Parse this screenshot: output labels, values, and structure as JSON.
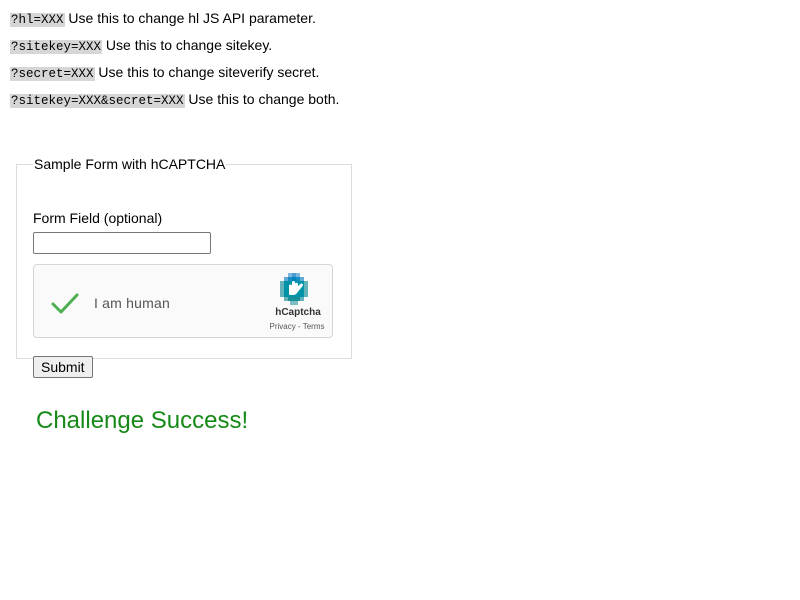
{
  "params": [
    {
      "code": "?hl=XXX",
      "text": " Use this to change hl JS API parameter."
    },
    {
      "code": "?sitekey=XXX",
      "text": " Use this to change sitekey."
    },
    {
      "code": "?secret=XXX",
      "text": " Use this to change siteverify secret."
    },
    {
      "code": "?sitekey=XXX&secret=XXX",
      "text": " Use this to change both."
    }
  ],
  "form": {
    "legend": "Sample Form with hCAPTCHA",
    "field_label": "Form Field (optional)",
    "field_value": "",
    "submit_label": "Submit"
  },
  "hcaptcha": {
    "status_text": "I am human",
    "brand": "hCaptcha",
    "privacy_link": "Privacy",
    "separator": " - ",
    "terms_link": "Terms",
    "checkmark_color": "#4caf50",
    "checked": true
  },
  "result": {
    "message": "Challenge Success!",
    "color": "#168a16"
  }
}
